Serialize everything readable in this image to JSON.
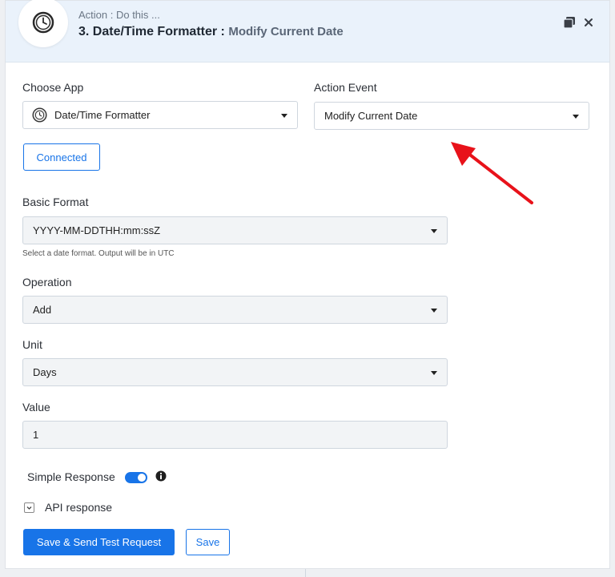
{
  "header": {
    "subtitle": "Action : Do this ...",
    "step_title": "3. Date/Time Formatter :",
    "event_name": "Modify Current Date"
  },
  "form": {
    "choose_app_label": "Choose App",
    "app_value": "Date/Time Formatter",
    "action_event_label": "Action Event",
    "action_event_value": "Modify Current Date",
    "connected_label": "Connected",
    "basic_format_label": "Basic Format",
    "basic_format_value": "YYYY-MM-DDTHH:mm:ssZ",
    "basic_format_hint": "Select a date format. Output will be in UTC",
    "operation_label": "Operation",
    "operation_value": "Add",
    "unit_label": "Unit",
    "unit_value": "Days",
    "value_label": "Value",
    "value_value": "1",
    "simple_response_label": "Simple Response",
    "simple_response_on": true,
    "api_response_label": "API response"
  },
  "buttons": {
    "save_send_label": "Save & Send Test Request",
    "save_label": "Save"
  },
  "icons": {
    "app": "clock-icon",
    "copy": "copy-icon",
    "close": "close-icon",
    "info": "info-icon",
    "chevron": "chevron-down-icon"
  },
  "colors": {
    "accent": "#1874e8",
    "header_bg": "#eaf2fb",
    "annotation_arrow": "#e8121a"
  }
}
